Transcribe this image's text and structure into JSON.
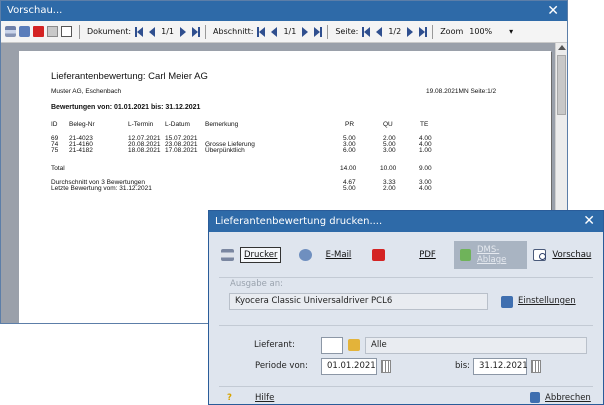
{
  "preview": {
    "title": "Vorschau...",
    "toolbar": {
      "dokument_label": "Dokument:",
      "dokument_page": "1/1",
      "abschnitt_label": "Abschnitt:",
      "abschnitt_page": "1/1",
      "seite_label": "Seite:",
      "seite_page": "1/2",
      "zoom_label": "Zoom",
      "zoom_value": "100%"
    },
    "report": {
      "title": "Lieferantenbewertung: Carl Meier AG",
      "company": "Muster AG, Eschenbach",
      "date_page": "19.08.2021MN Seite:1/2",
      "range": "Bewertungen von: 01.01.2021 bis: 31.12.2021",
      "headers": [
        "ID",
        "Beleg-Nr",
        "L-Termin",
        "L-Datum",
        "Bemerkung",
        "PR",
        "QU",
        "TE"
      ],
      "rows": [
        [
          "69",
          "21-4023",
          "12.07.2021",
          "15.07.2021",
          "",
          "5.00",
          "2.00",
          "4.00"
        ],
        [
          "74",
          "21-4160",
          "20.08.2021",
          "23.08.2021",
          "Grosse Lieferung",
          "3.00",
          "5.00",
          "4.00"
        ],
        [
          "75",
          "21-4182",
          "18.08.2021",
          "17.08.2021",
          "Überpünktlich",
          "6.00",
          "3.00",
          "1.00"
        ]
      ],
      "total_label": "Total",
      "total": [
        "14.00",
        "10.00",
        "9.00"
      ],
      "avg_label": "Durchschnitt von 3 Bewertungen",
      "avg": [
        "4.67",
        "3.33",
        "3.00"
      ],
      "last_label": "Letzte Bewertung vom: 31.12.2021",
      "last": [
        "5.00",
        "2.00",
        "4.00"
      ]
    }
  },
  "dialog": {
    "title": "Lieferantenbewertung drucken....",
    "buttons": {
      "drucker": "Drucker",
      "email": "E-Mail",
      "pdf": "PDF",
      "dms": "DMS-Ablage",
      "vorschau": "Vorschau"
    },
    "ausgabe_label": "Ausgabe an:",
    "printer_name": "Kyocera Classic Universaldriver PCL6",
    "einstellungen": "Einstellungen",
    "lieferant_label": "Lieferant:",
    "lieferant_value": "",
    "alle": "Alle",
    "periode_label": "Periode von:",
    "periode_von": "01.01.2021",
    "bis_label": "bis:",
    "periode_bis": "31.12.2021",
    "hilfe": "Hilfe",
    "abbrechen": "Abbrechen"
  }
}
